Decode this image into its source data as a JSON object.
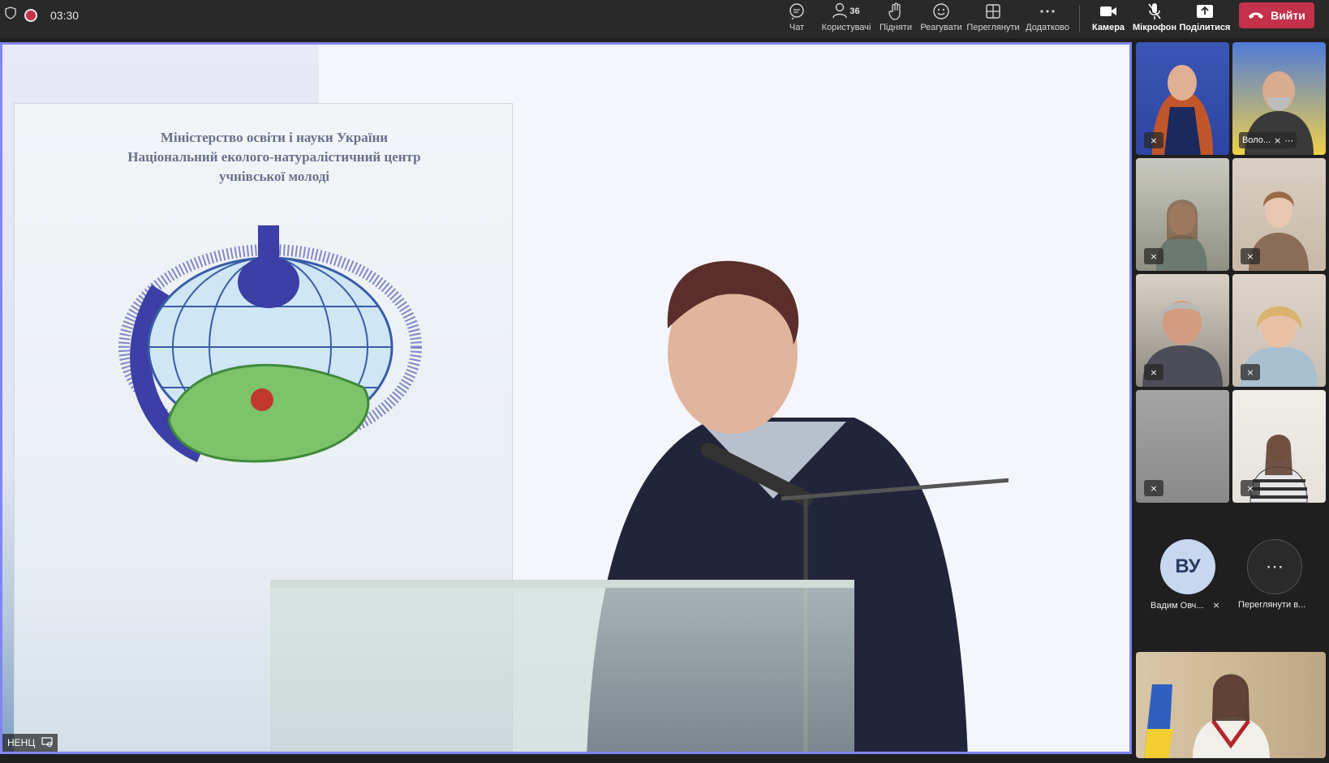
{
  "status": {
    "timer": "03:30"
  },
  "toolbar": {
    "chat": "Чат",
    "people": "Користувачі",
    "people_count": "36",
    "raise": "Підняти",
    "react": "Реагувати",
    "view": "Переглянути",
    "more": "Додатково",
    "camera": "Камера",
    "mic": "Мікрофон",
    "share": "Поділитися",
    "leave": "Вийти"
  },
  "main_stage": {
    "presenter_tag": "НЕНЦ",
    "banner_lines": [
      "Міністерство освіти і науки України",
      "Національний еколого-натуралістичний центр",
      "учнівської молоді"
    ]
  },
  "participants": {
    "tile_names": [
      "Воло..."
    ],
    "avatar_initials": "ВУ",
    "avatar_name": "Вадим Овч...",
    "view_more": "Переглянути в..."
  },
  "colors": {
    "topbar": "#292929",
    "leave_button": "#c4314b",
    "active_speaker_border": "#7f85f5"
  }
}
